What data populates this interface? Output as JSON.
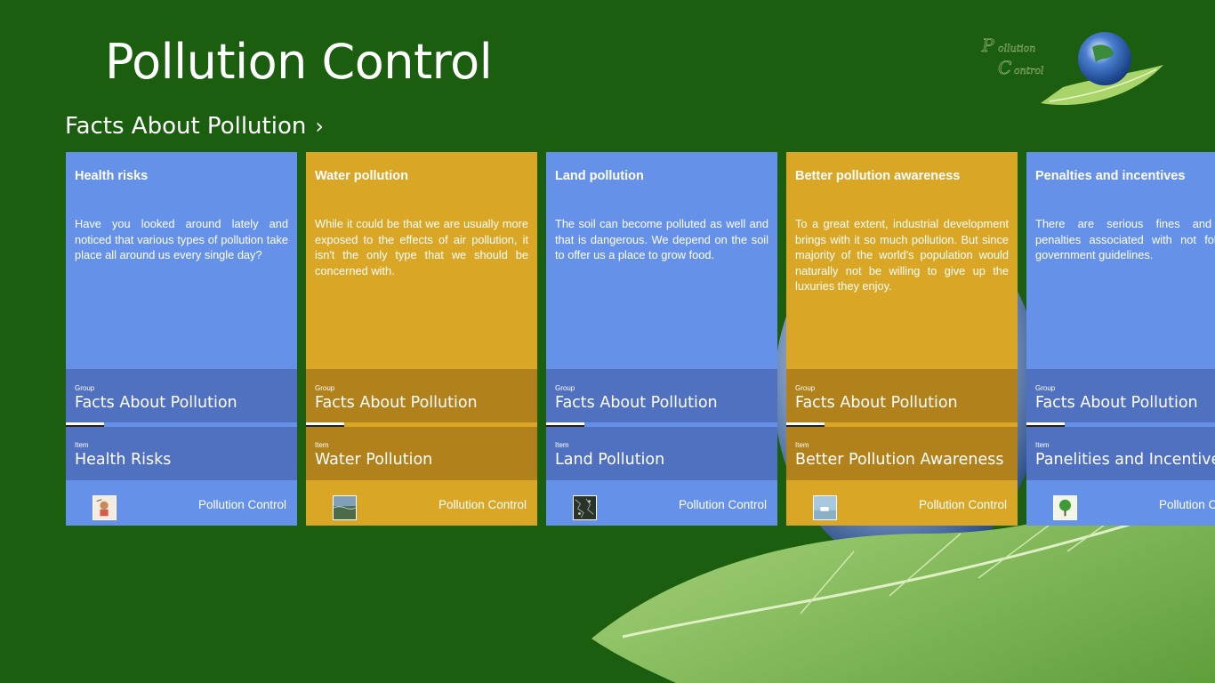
{
  "app": {
    "title": "Pollution Control"
  },
  "logo": {
    "icon": "pollution-control-logo-icon"
  },
  "group": {
    "title": "Facts About Pollution",
    "chevron": "›"
  },
  "labels": {
    "group": "Group",
    "item": "Item"
  },
  "colors": {
    "background": "#1b5e10",
    "blue": "#6591e8",
    "gold": "#d9a625"
  },
  "tiles": [
    {
      "title": "Health risks",
      "description": "Have you looked around lately and noticed that various types of pollution take place all around us every single day?",
      "group": "Facts About Pollution",
      "item": "Health Risks",
      "footer": "Pollution Control",
      "thumb_icon": "health-risks-thumbnail-icon",
      "color": "blue"
    },
    {
      "title": "Water pollution",
      "description": "While it could be that we are usually more exposed to the effects of air pollution, it isn't the only type that we should be concerned with.",
      "group": "Facts About Pollution",
      "item": "Water Pollution",
      "footer": "Pollution Control",
      "thumb_icon": "water-pollution-thumbnail-icon",
      "color": "gold"
    },
    {
      "title": "Land pollution",
      "description": "The soil can become polluted as well and that is dangerous. We depend on the soil to offer us a place to grow food.",
      "group": "Facts About Pollution",
      "item": "Land Pollution",
      "footer": "Pollution Control",
      "thumb_icon": "land-pollution-thumbnail-icon",
      "color": "blue"
    },
    {
      "title": "Better pollution awareness",
      "description": "To a great extent, industrial development brings with it so much pollution.  But since  majority of the world's population would naturally not be willing to give up the luxuries they enjoy.",
      "group": "Facts About Pollution",
      "item": "Better Pollution Awareness",
      "footer": "Pollution Control",
      "thumb_icon": "awareness-thumbnail-icon",
      "color": "gold"
    },
    {
      "title": "Penalties and incentives",
      "description": "There are serious fines and even penalties associated with not following government guidelines.",
      "group": "Facts About Pollution",
      "item": "Panelities and Incentives",
      "footer": "Pollution Control",
      "thumb_icon": "tree-thumbnail-icon",
      "color": "blue"
    }
  ]
}
